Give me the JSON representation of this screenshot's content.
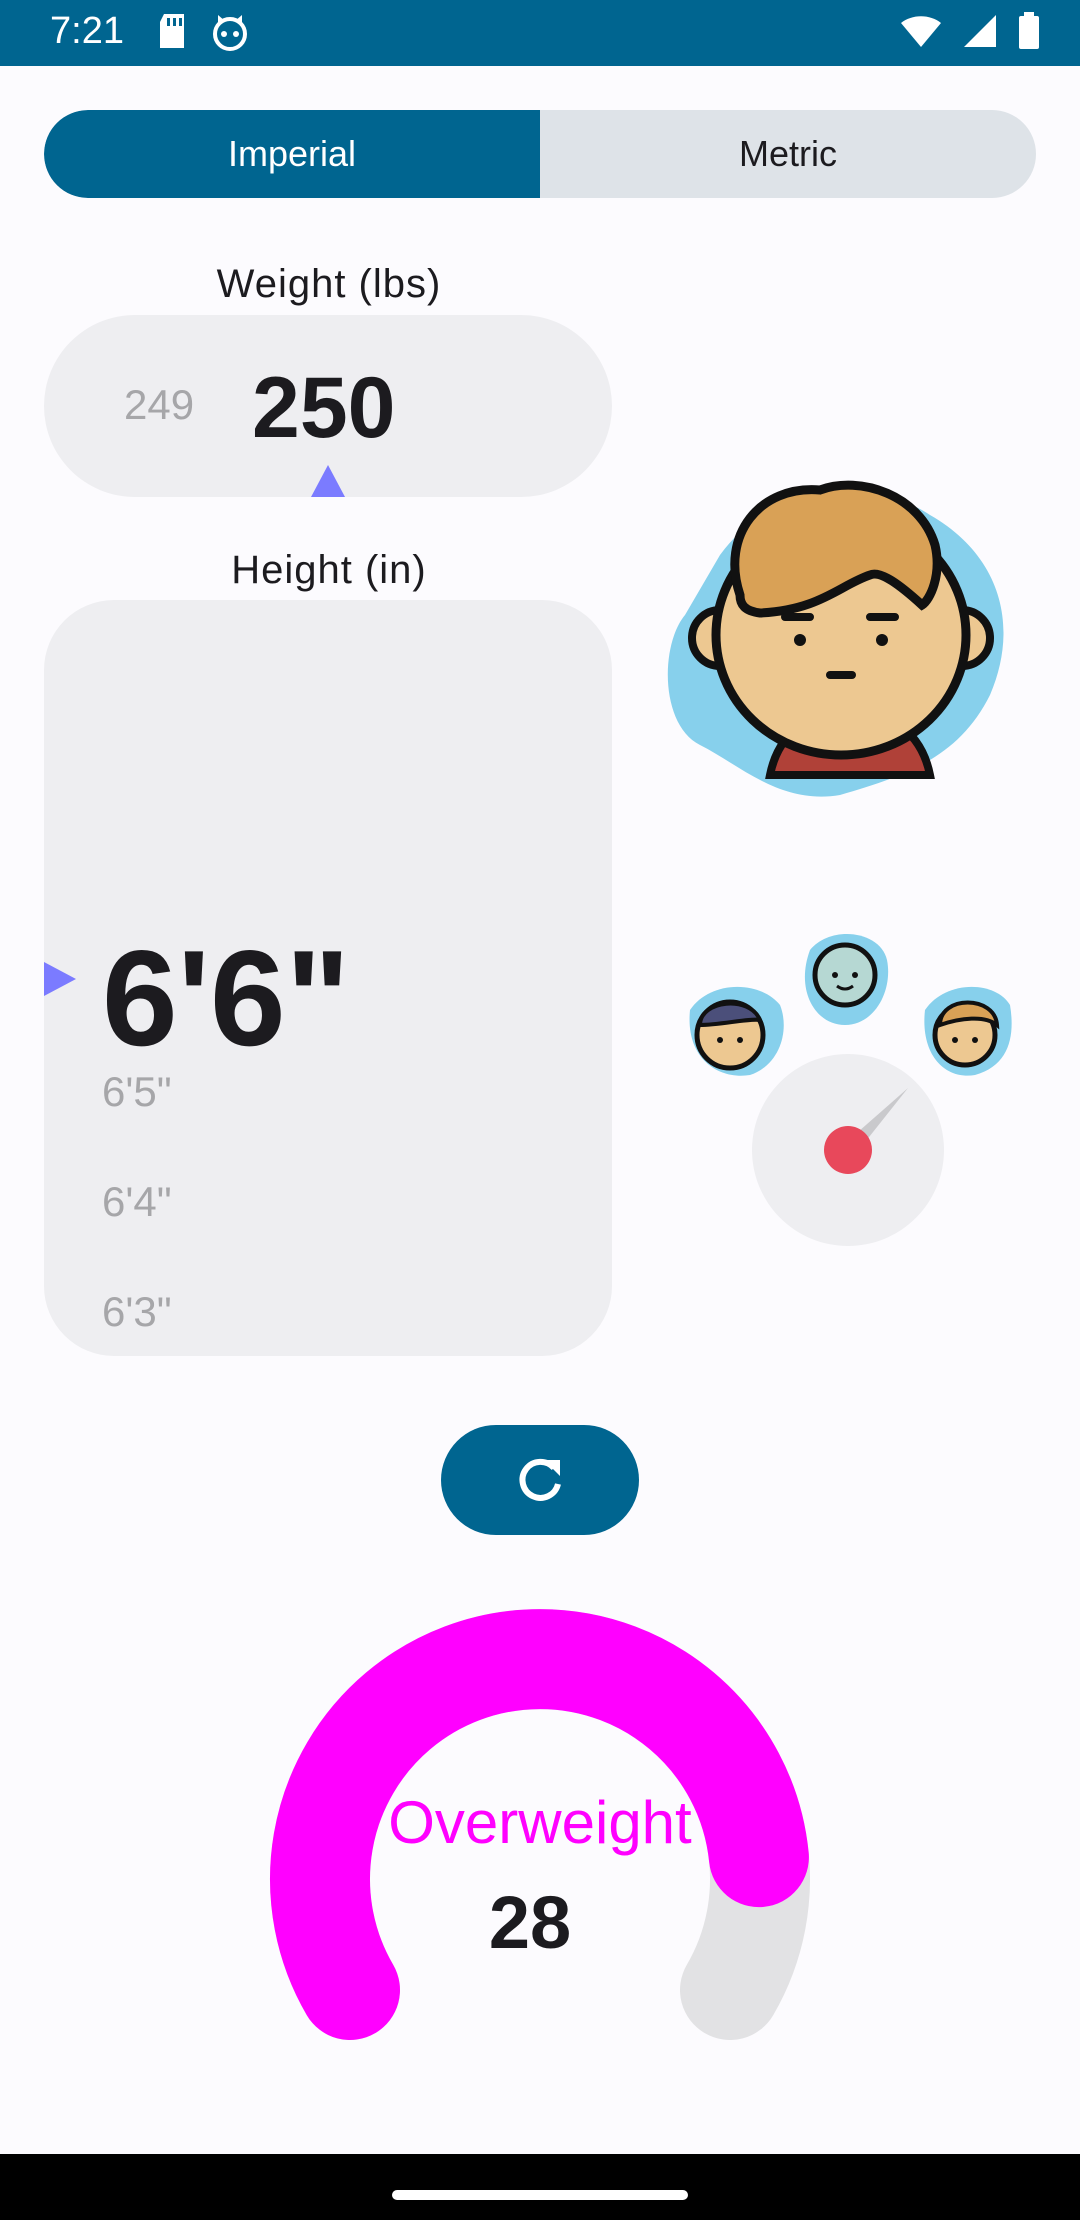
{
  "status_bar": {
    "time": "7:21",
    "left_icons": [
      "sd-card-icon",
      "cat-face-icon"
    ],
    "right_icons": [
      "wifi-icon",
      "cellular-signal-icon",
      "battery-icon"
    ]
  },
  "unit_toggle": {
    "options": [
      "Imperial",
      "Metric"
    ],
    "selected": "Imperial"
  },
  "weight": {
    "label": "Weight (lbs)",
    "previous_value": "249",
    "current_value": "250"
  },
  "height": {
    "label": "Height (in)",
    "current_value": "6'6\"",
    "following_values": [
      "6'5\"",
      "6'4\"",
      "6'3\""
    ]
  },
  "refresh": {
    "icon": "refresh-icon"
  },
  "result": {
    "category": "Overweight",
    "bmi": "28",
    "category_color": "#ff00ff",
    "gauge_fill_fraction": 0.85
  },
  "colors": {
    "primary": "#006590",
    "accent_pointer": "#7b7bff",
    "needle_dot": "#e8485b"
  }
}
